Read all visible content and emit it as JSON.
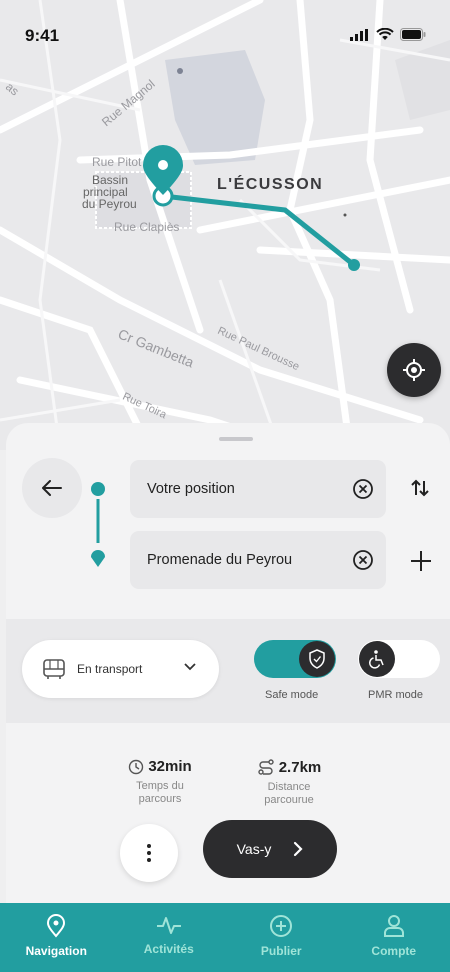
{
  "status_bar": {
    "time": "9:41"
  },
  "map": {
    "streets": [
      "Rue Magnol",
      "Rue Pitot",
      "Rue Clapiès",
      "Cr Gambetta",
      "Rue Paul Brousse",
      "Rue Toira",
      "as"
    ],
    "poi": "Bassin principal du Peyrou",
    "poi_lines": [
      "Bassin",
      "principal",
      "du Peyrou"
    ],
    "district": "L'ÉCUSSON",
    "route_color": "#229ea0"
  },
  "route": {
    "origin_value": "Votre position",
    "destination_value": "Promenade du Peyrou"
  },
  "options": {
    "transport_mode": "En transport",
    "safe_mode_label": "Safe mode",
    "safe_mode_on": true,
    "pmr_mode_label": "PMR mode",
    "pmr_mode_on": false
  },
  "summary": {
    "duration": "32min",
    "duration_caption": "Temps du parcours",
    "distance": "2.7km",
    "distance_caption": "Distance parcourue"
  },
  "actions": {
    "go_label": "Vas-y"
  },
  "tabs": [
    {
      "label": "Navigation",
      "icon": "location-pin-icon",
      "active": true
    },
    {
      "label": "Activités",
      "icon": "activity-pulse-icon",
      "active": false
    },
    {
      "label": "Publier",
      "icon": "plus-circle-icon",
      "active": false
    },
    {
      "label": "Compte",
      "icon": "user-icon",
      "active": false
    }
  ],
  "colors": {
    "accent": "#229ea0",
    "dark": "#2c2c2e",
    "tab_inactive": "#9fe4d8"
  }
}
